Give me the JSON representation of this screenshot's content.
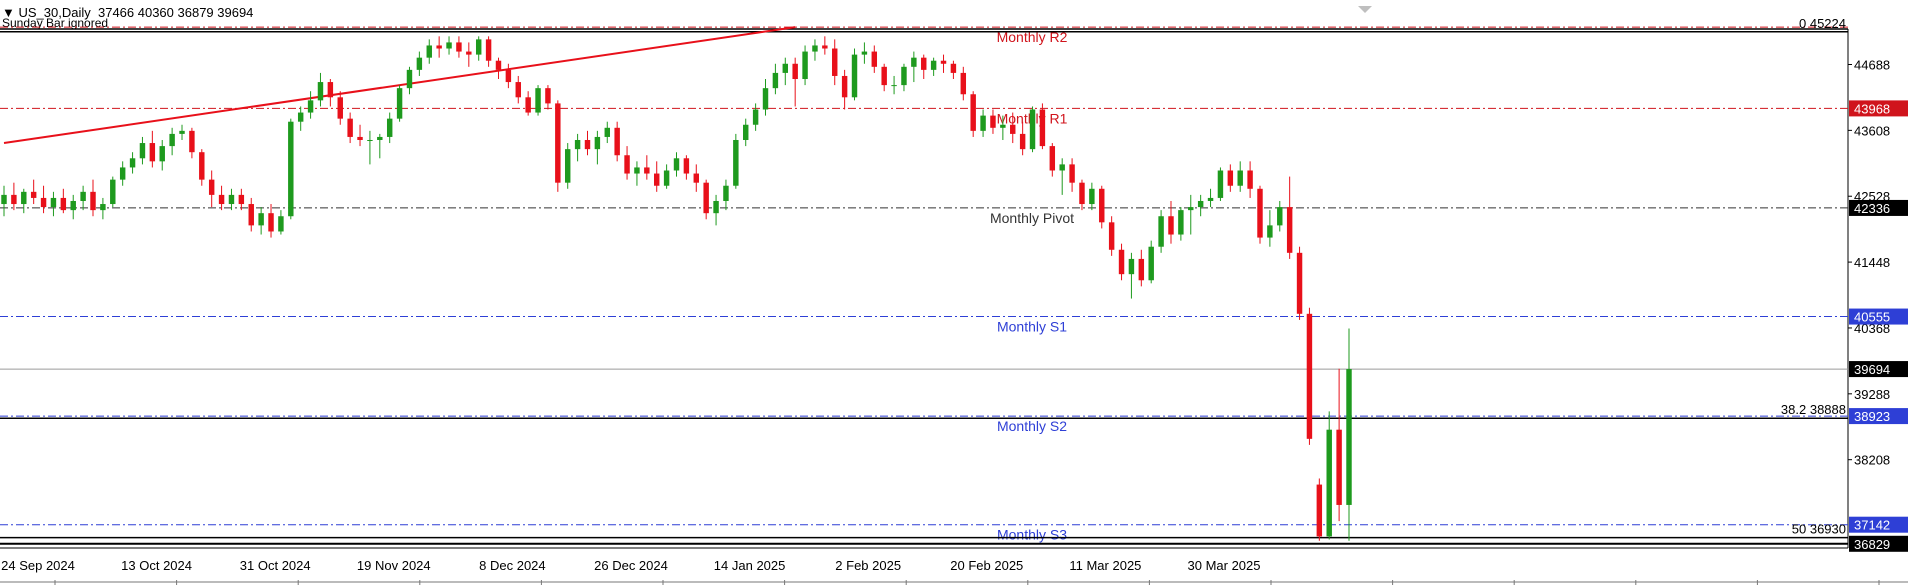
{
  "header": {
    "symbol_line": "US_30,Daily  37466 40360 36879 39694",
    "note": "Sunday Bar ignored"
  },
  "colors": {
    "bull": "#1e9a1e",
    "bear": "#e8101a",
    "pivot": "#333333",
    "support": "#2e3fd6",
    "resistance": "#d0141c",
    "trend": "#e8101a",
    "price_tag": "#000000"
  },
  "chart_data": {
    "type": "candlestick",
    "symbol": "US_30",
    "timeframe": "Daily",
    "last_bar": {
      "open": 37466,
      "high": 40360,
      "low": 36879,
      "close": 39694
    },
    "ylim": [
      36760,
      45270
    ],
    "y_ticks": [
      44688,
      43608,
      42528,
      41448,
      40368,
      39288,
      38208
    ],
    "x_ticks": [
      "24 Sep 2024",
      "13 Oct 2024",
      "31 Oct 2024",
      "19 Nov 2024",
      "8 Dec 2024",
      "26 Dec 2024",
      "14 Jan 2025",
      "2 Feb 2025",
      "20 Feb 2025",
      "11 Mar 2025",
      "30 Mar 2025"
    ],
    "levels": [
      {
        "name": "Monthly R2",
        "value": 45300,
        "kind": "resistance"
      },
      {
        "name": "Monthly R1",
        "value": 43968,
        "kind": "resistance"
      },
      {
        "name": "Monthly Pivot",
        "value": 42336,
        "kind": "pivot"
      },
      {
        "name": "Monthly S1",
        "value": 40555,
        "kind": "support"
      },
      {
        "name": "Monthly S2",
        "value": 38923,
        "kind": "support"
      },
      {
        "name": "Monthly S3",
        "value": 37142,
        "kind": "support"
      }
    ],
    "fib_levels": [
      {
        "label": "0 45224",
        "value": 45224
      },
      {
        "label": "38.2 38888",
        "value": 38888
      },
      {
        "label": "50 36930",
        "value": 36930
      }
    ],
    "price_tags": [
      {
        "label": "43968",
        "value": 43968,
        "kind": "resistance"
      },
      {
        "label": "42336",
        "value": 42336,
        "kind": "pivot"
      },
      {
        "label": "40555",
        "value": 40555,
        "kind": "support"
      },
      {
        "label": "39694",
        "value": 39694,
        "kind": "price"
      },
      {
        "label": "38923",
        "value": 38923,
        "kind": "support"
      },
      {
        "label": "37142",
        "value": 37142,
        "kind": "support"
      },
      {
        "label": "36829",
        "value": 36829,
        "kind": "price"
      }
    ],
    "horizontal_lines": [
      {
        "value": 39694,
        "style": "price"
      },
      {
        "value": 36829,
        "style": "price"
      }
    ],
    "trendline": {
      "from": {
        "bar": 0,
        "value": 43400
      },
      "to": {
        "bar": 80,
        "value": 45300
      }
    },
    "candles": [
      {
        "o": 42400,
        "h": 42700,
        "l": 42200,
        "c": 42550
      },
      {
        "o": 42550,
        "h": 42750,
        "l": 42300,
        "c": 42400
      },
      {
        "o": 42400,
        "h": 42650,
        "l": 42250,
        "c": 42600
      },
      {
        "o": 42600,
        "h": 42800,
        "l": 42400,
        "c": 42500
      },
      {
        "o": 42500,
        "h": 42700,
        "l": 42250,
        "c": 42350
      },
      {
        "o": 42350,
        "h": 42600,
        "l": 42200,
        "c": 42500
      },
      {
        "o": 42500,
        "h": 42650,
        "l": 42250,
        "c": 42300
      },
      {
        "o": 42300,
        "h": 42550,
        "l": 42150,
        "c": 42450
      },
      {
        "o": 42450,
        "h": 42700,
        "l": 42300,
        "c": 42600
      },
      {
        "o": 42600,
        "h": 42800,
        "l": 42200,
        "c": 42300
      },
      {
        "o": 42300,
        "h": 42500,
        "l": 42150,
        "c": 42400
      },
      {
        "o": 42400,
        "h": 42850,
        "l": 42350,
        "c": 42800
      },
      {
        "o": 42800,
        "h": 43100,
        "l": 42700,
        "c": 43000
      },
      {
        "o": 43000,
        "h": 43250,
        "l": 42900,
        "c": 43150
      },
      {
        "o": 43150,
        "h": 43500,
        "l": 43050,
        "c": 43400
      },
      {
        "o": 43400,
        "h": 43600,
        "l": 43000,
        "c": 43100
      },
      {
        "o": 43100,
        "h": 43450,
        "l": 42950,
        "c": 43350
      },
      {
        "o": 43350,
        "h": 43650,
        "l": 43200,
        "c": 43550
      },
      {
        "o": 43550,
        "h": 43700,
        "l": 43450,
        "c": 43600
      },
      {
        "o": 43600,
        "h": 43650,
        "l": 43150,
        "c": 43250
      },
      {
        "o": 43250,
        "h": 43300,
        "l": 42700,
        "c": 42800
      },
      {
        "o": 42800,
        "h": 42950,
        "l": 42350,
        "c": 42550
      },
      {
        "o": 42550,
        "h": 42700,
        "l": 42300,
        "c": 42400
      },
      {
        "o": 42400,
        "h": 42650,
        "l": 42300,
        "c": 42550
      },
      {
        "o": 42550,
        "h": 42650,
        "l": 42300,
        "c": 42400
      },
      {
        "o": 42400,
        "h": 42500,
        "l": 41950,
        "c": 42050
      },
      {
        "o": 42050,
        "h": 42350,
        "l": 41900,
        "c": 42250
      },
      {
        "o": 42250,
        "h": 42400,
        "l": 41850,
        "c": 41950
      },
      {
        "o": 41950,
        "h": 42300,
        "l": 41900,
        "c": 42200
      },
      {
        "o": 42200,
        "h": 43800,
        "l": 42150,
        "c": 43750
      },
      {
        "o": 43750,
        "h": 44000,
        "l": 43600,
        "c": 43900
      },
      {
        "o": 43900,
        "h": 44250,
        "l": 43800,
        "c": 44100
      },
      {
        "o": 44100,
        "h": 44550,
        "l": 44000,
        "c": 44400
      },
      {
        "o": 44400,
        "h": 44450,
        "l": 44000,
        "c": 44150
      },
      {
        "o": 44150,
        "h": 44250,
        "l": 43700,
        "c": 43800
      },
      {
        "o": 43800,
        "h": 43900,
        "l": 43400,
        "c": 43500
      },
      {
        "o": 43500,
        "h": 43700,
        "l": 43350,
        "c": 43450
      },
      {
        "o": 43450,
        "h": 43600,
        "l": 43050,
        "c": 43450
      },
      {
        "o": 43450,
        "h": 43550,
        "l": 43150,
        "c": 43500
      },
      {
        "o": 43500,
        "h": 43900,
        "l": 43400,
        "c": 43800
      },
      {
        "o": 43800,
        "h": 44350,
        "l": 43750,
        "c": 44300
      },
      {
        "o": 44300,
        "h": 44650,
        "l": 44200,
        "c": 44600
      },
      {
        "o": 44600,
        "h": 44900,
        "l": 44500,
        "c": 44800
      },
      {
        "o": 44800,
        "h": 45100,
        "l": 44700,
        "c": 45000
      },
      {
        "o": 45000,
        "h": 45150,
        "l": 44800,
        "c": 44950
      },
      {
        "o": 44950,
        "h": 45150,
        "l": 44850,
        "c": 45050
      },
      {
        "o": 45050,
        "h": 45150,
        "l": 44800,
        "c": 44900
      },
      {
        "o": 44900,
        "h": 45050,
        "l": 44650,
        "c": 44850
      },
      {
        "o": 44850,
        "h": 45150,
        "l": 44750,
        "c": 45100
      },
      {
        "o": 45100,
        "h": 45150,
        "l": 44650,
        "c": 44750
      },
      {
        "o": 44750,
        "h": 44800,
        "l": 44450,
        "c": 44600
      },
      {
        "o": 44600,
        "h": 44700,
        "l": 44300,
        "c": 44400
      },
      {
        "o": 44400,
        "h": 44500,
        "l": 44050,
        "c": 44150
      },
      {
        "o": 44150,
        "h": 44250,
        "l": 43850,
        "c": 43900
      },
      {
        "o": 43900,
        "h": 44350,
        "l": 43850,
        "c": 44300
      },
      {
        "o": 44300,
        "h": 44350,
        "l": 43950,
        "c": 44050
      },
      {
        "o": 44050,
        "h": 44100,
        "l": 42600,
        "c": 42750
      },
      {
        "o": 42750,
        "h": 43400,
        "l": 42650,
        "c": 43300
      },
      {
        "o": 43300,
        "h": 43550,
        "l": 43100,
        "c": 43450
      },
      {
        "o": 43450,
        "h": 43600,
        "l": 43200,
        "c": 43300
      },
      {
        "o": 43300,
        "h": 43600,
        "l": 43050,
        "c": 43500
      },
      {
        "o": 43500,
        "h": 43750,
        "l": 43400,
        "c": 43650
      },
      {
        "o": 43650,
        "h": 43750,
        "l": 43100,
        "c": 43200
      },
      {
        "o": 43200,
        "h": 43350,
        "l": 42800,
        "c": 42900
      },
      {
        "o": 42900,
        "h": 43100,
        "l": 42700,
        "c": 43000
      },
      {
        "o": 43000,
        "h": 43200,
        "l": 42800,
        "c": 42900
      },
      {
        "o": 42900,
        "h": 43100,
        "l": 42600,
        "c": 42700
      },
      {
        "o": 42700,
        "h": 43050,
        "l": 42650,
        "c": 42950
      },
      {
        "o": 42950,
        "h": 43250,
        "l": 42850,
        "c": 43150
      },
      {
        "o": 43150,
        "h": 43200,
        "l": 42800,
        "c": 42900
      },
      {
        "o": 42900,
        "h": 43050,
        "l": 42600,
        "c": 42750
      },
      {
        "o": 42750,
        "h": 42800,
        "l": 42150,
        "c": 42250
      },
      {
        "o": 42250,
        "h": 42550,
        "l": 42050,
        "c": 42450
      },
      {
        "o": 42450,
        "h": 42800,
        "l": 42300,
        "c": 42700
      },
      {
        "o": 42700,
        "h": 43550,
        "l": 42650,
        "c": 43450
      },
      {
        "o": 43450,
        "h": 43800,
        "l": 43350,
        "c": 43700
      },
      {
        "o": 43700,
        "h": 44050,
        "l": 43600,
        "c": 43950
      },
      {
        "o": 43950,
        "h": 44450,
        "l": 43850,
        "c": 44300
      },
      {
        "o": 44300,
        "h": 44700,
        "l": 44200,
        "c": 44550
      },
      {
        "o": 44550,
        "h": 44800,
        "l": 44350,
        "c": 44700
      },
      {
        "o": 44700,
        "h": 44800,
        "l": 44000,
        "c": 44450
      },
      {
        "o": 44450,
        "h": 45000,
        "l": 44350,
        "c": 44900
      },
      {
        "o": 44900,
        "h": 45100,
        "l": 44750,
        "c": 45000
      },
      {
        "o": 45000,
        "h": 45150,
        "l": 44850,
        "c": 44950
      },
      {
        "o": 44950,
        "h": 45100,
        "l": 44350,
        "c": 44500
      },
      {
        "o": 44500,
        "h": 44600,
        "l": 43950,
        "c": 44150
      },
      {
        "o": 44150,
        "h": 44950,
        "l": 44100,
        "c": 44850
      },
      {
        "o": 44850,
        "h": 45050,
        "l": 44700,
        "c": 44900
      },
      {
        "o": 44900,
        "h": 45000,
        "l": 44550,
        "c": 44650
      },
      {
        "o": 44650,
        "h": 44700,
        "l": 44250,
        "c": 44350
      },
      {
        "o": 44350,
        "h": 44500,
        "l": 44200,
        "c": 44350
      },
      {
        "o": 44350,
        "h": 44700,
        "l": 44250,
        "c": 44650
      },
      {
        "o": 44650,
        "h": 44900,
        "l": 44400,
        "c": 44800
      },
      {
        "o": 44800,
        "h": 44850,
        "l": 44450,
        "c": 44600
      },
      {
        "o": 44600,
        "h": 44800,
        "l": 44500,
        "c": 44750
      },
      {
        "o": 44750,
        "h": 44850,
        "l": 44550,
        "c": 44700
      },
      {
        "o": 44700,
        "h": 44750,
        "l": 44450,
        "c": 44550
      },
      {
        "o": 44550,
        "h": 44650,
        "l": 44100,
        "c": 44200
      },
      {
        "o": 44200,
        "h": 44250,
        "l": 43500,
        "c": 43600
      },
      {
        "o": 43600,
        "h": 43950,
        "l": 43500,
        "c": 43850
      },
      {
        "o": 43850,
        "h": 43950,
        "l": 43550,
        "c": 43650
      },
      {
        "o": 43650,
        "h": 43850,
        "l": 43450,
        "c": 43700
      },
      {
        "o": 43700,
        "h": 43900,
        "l": 43400,
        "c": 43550
      },
      {
        "o": 43550,
        "h": 43750,
        "l": 43200,
        "c": 43300
      },
      {
        "o": 43300,
        "h": 44000,
        "l": 43250,
        "c": 43950
      },
      {
        "o": 43950,
        "h": 44050,
        "l": 43300,
        "c": 43350
      },
      {
        "o": 43350,
        "h": 43400,
        "l": 42850,
        "c": 42950
      },
      {
        "o": 42950,
        "h": 43150,
        "l": 42550,
        "c": 43050
      },
      {
        "o": 43050,
        "h": 43150,
        "l": 42600,
        "c": 42750
      },
      {
        "o": 42750,
        "h": 42800,
        "l": 42300,
        "c": 42400
      },
      {
        "o": 42400,
        "h": 42750,
        "l": 42300,
        "c": 42650
      },
      {
        "o": 42650,
        "h": 42700,
        "l": 42000,
        "c": 42100
      },
      {
        "o": 42100,
        "h": 42200,
        "l": 41550,
        "c": 41650
      },
      {
        "o": 41650,
        "h": 41750,
        "l": 41150,
        "c": 41250
      },
      {
        "o": 41250,
        "h": 41600,
        "l": 40850,
        "c": 41500
      },
      {
        "o": 41500,
        "h": 41650,
        "l": 41050,
        "c": 41150
      },
      {
        "o": 41150,
        "h": 41800,
        "l": 41100,
        "c": 41700
      },
      {
        "o": 41700,
        "h": 42300,
        "l": 41600,
        "c": 42200
      },
      {
        "o": 42200,
        "h": 42450,
        "l": 41750,
        "c": 41900
      },
      {
        "o": 41900,
        "h": 42350,
        "l": 41800,
        "c": 42300
      },
      {
        "o": 42300,
        "h": 42550,
        "l": 41900,
        "c": 42350
      },
      {
        "o": 42350,
        "h": 42550,
        "l": 42200,
        "c": 42450
      },
      {
        "o": 42450,
        "h": 42650,
        "l": 42350,
        "c": 42500
      },
      {
        "o": 42500,
        "h": 43000,
        "l": 42450,
        "c": 42950
      },
      {
        "o": 42950,
        "h": 43050,
        "l": 42600,
        "c": 42700
      },
      {
        "o": 42700,
        "h": 43100,
        "l": 42600,
        "c": 42950
      },
      {
        "o": 42950,
        "h": 43100,
        "l": 42500,
        "c": 42650
      },
      {
        "o": 42650,
        "h": 42700,
        "l": 41750,
        "c": 41850
      },
      {
        "o": 41850,
        "h": 42300,
        "l": 41700,
        "c": 42050
      },
      {
        "o": 42050,
        "h": 42450,
        "l": 41950,
        "c": 42350
      },
      {
        "o": 42350,
        "h": 42850,
        "l": 41500,
        "c": 41600
      },
      {
        "o": 41600,
        "h": 41700,
        "l": 40500,
        "c": 40600
      },
      {
        "o": 40600,
        "h": 40700,
        "l": 38450,
        "c": 38550
      },
      {
        "o": 37800,
        "h": 37900,
        "l": 36879,
        "c": 36950
      },
      {
        "o": 36950,
        "h": 39000,
        "l": 36900,
        "c": 38700
      },
      {
        "o": 38700,
        "h": 39700,
        "l": 37200,
        "c": 37466
      },
      {
        "o": 37466,
        "h": 40360,
        "l": 36879,
        "c": 39694
      }
    ]
  }
}
